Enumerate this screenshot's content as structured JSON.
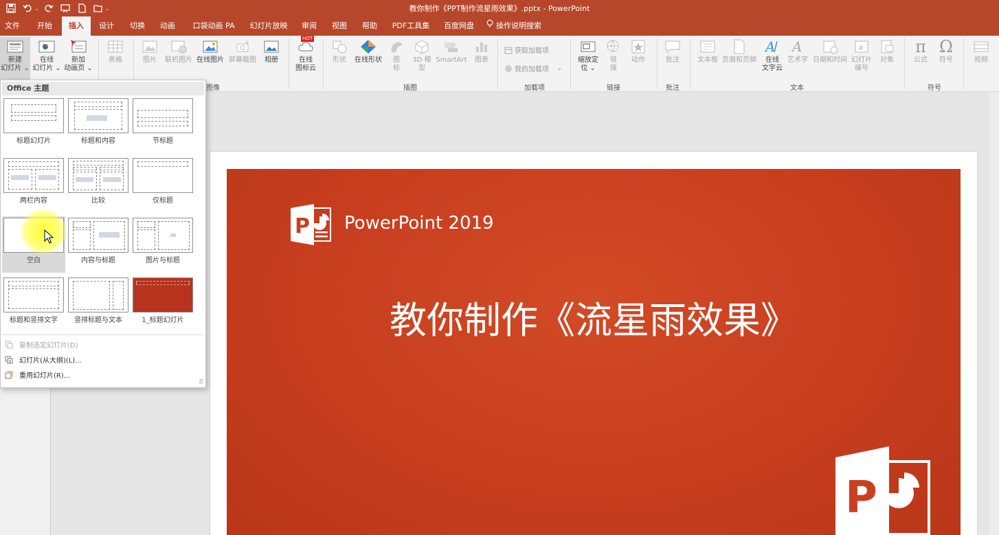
{
  "window": {
    "title": "教你制作《PPT制作流星雨效果》.pptx  -  PowerPoint"
  },
  "quick_access": {
    "undo_caret": "⌄",
    "more_caret": "⌄"
  },
  "tabs": [
    {
      "label": "文件"
    },
    {
      "label": "开始"
    },
    {
      "label": "插入"
    },
    {
      "label": "设计"
    },
    {
      "label": "切换"
    },
    {
      "label": "动画"
    },
    {
      "label": "口袋动画 PA"
    },
    {
      "label": "幻灯片放映"
    },
    {
      "label": "审阅"
    },
    {
      "label": "视图"
    },
    {
      "label": "帮助"
    },
    {
      "label": "PDF工具集"
    },
    {
      "label": "百度网盘"
    },
    {
      "label": "操作说明搜索"
    }
  ],
  "active_tab": "插入",
  "ribbon": {
    "new_slide": "新建\n幻灯片 ⌄",
    "online_slide": "在线\n幻灯片 ⌄",
    "new_anim_page": "新加\n动画页 ⌄",
    "table": "表格",
    "picture": "图片",
    "online_picture_link": "联机图片",
    "online_picture": "在线图片",
    "screenshot": "屏幕截图",
    "album": "相册",
    "online_icon_cloud": "在线\n图标云",
    "hot_badge": "HOT",
    "shapes": "形状",
    "online_shapes": "在线形状",
    "icons": "图\n标",
    "model3d": "3D 模\n型",
    "smartart": "SmartArt",
    "chart": "图表",
    "get_addins": "获取加载项",
    "my_addins": "我的加载项",
    "zoom": "缩放定\n位 ⌄",
    "link": "链\n接",
    "action": "动作",
    "comment": "批注",
    "textbox": "文本框",
    "header_footer": "页眉和页脚",
    "online_wordart": "在线\n文字云",
    "wordart": "艺术字",
    "datetime": "日期和时间",
    "slide_number": "幻灯片\n编号",
    "object": "对象",
    "equation": "公式",
    "symbol": "符号",
    "video": "视频",
    "groups": {
      "images_partial": "图像",
      "illustrations": "插图",
      "addins": "加载项",
      "links": "链接",
      "comments": "批注",
      "text": "文本",
      "symbols": "符号"
    }
  },
  "dropdown": {
    "header": "Office 主题",
    "layouts": [
      {
        "label": "标题幻灯片"
      },
      {
        "label": "标题和内容"
      },
      {
        "label": "节标题"
      },
      {
        "label": "两栏内容"
      },
      {
        "label": "比较"
      },
      {
        "label": "仅标题"
      },
      {
        "label": "空白"
      },
      {
        "label": "内容与标题"
      },
      {
        "label": "图片与标题"
      },
      {
        "label": "标题和竖排文字"
      },
      {
        "label": "竖排标题与文本"
      },
      {
        "label": "1_标题幻灯片"
      }
    ],
    "hovered": "空白",
    "menu": [
      {
        "label": "复制选定幻灯片(D)",
        "disabled": true
      },
      {
        "label": "幻灯片(从大纲)(L)...",
        "disabled": false
      },
      {
        "label": "重用幻灯片(R)...",
        "disabled": false
      }
    ],
    "grip": "⠿"
  },
  "slide": {
    "brand": "PowerPoint 2019",
    "title": "教你制作《流星雨效果》",
    "logo_letter": "P"
  },
  "colors": {
    "accent": "#b7472a",
    "slide_bg": "#c73e1f"
  },
  "icons": [
    "save-icon",
    "undo-icon",
    "redo-icon",
    "present-icon",
    "new-file-icon",
    "open-folder-icon",
    "lightbulb-icon",
    "powerpoint-logo-icon",
    "cursor-icon"
  ]
}
